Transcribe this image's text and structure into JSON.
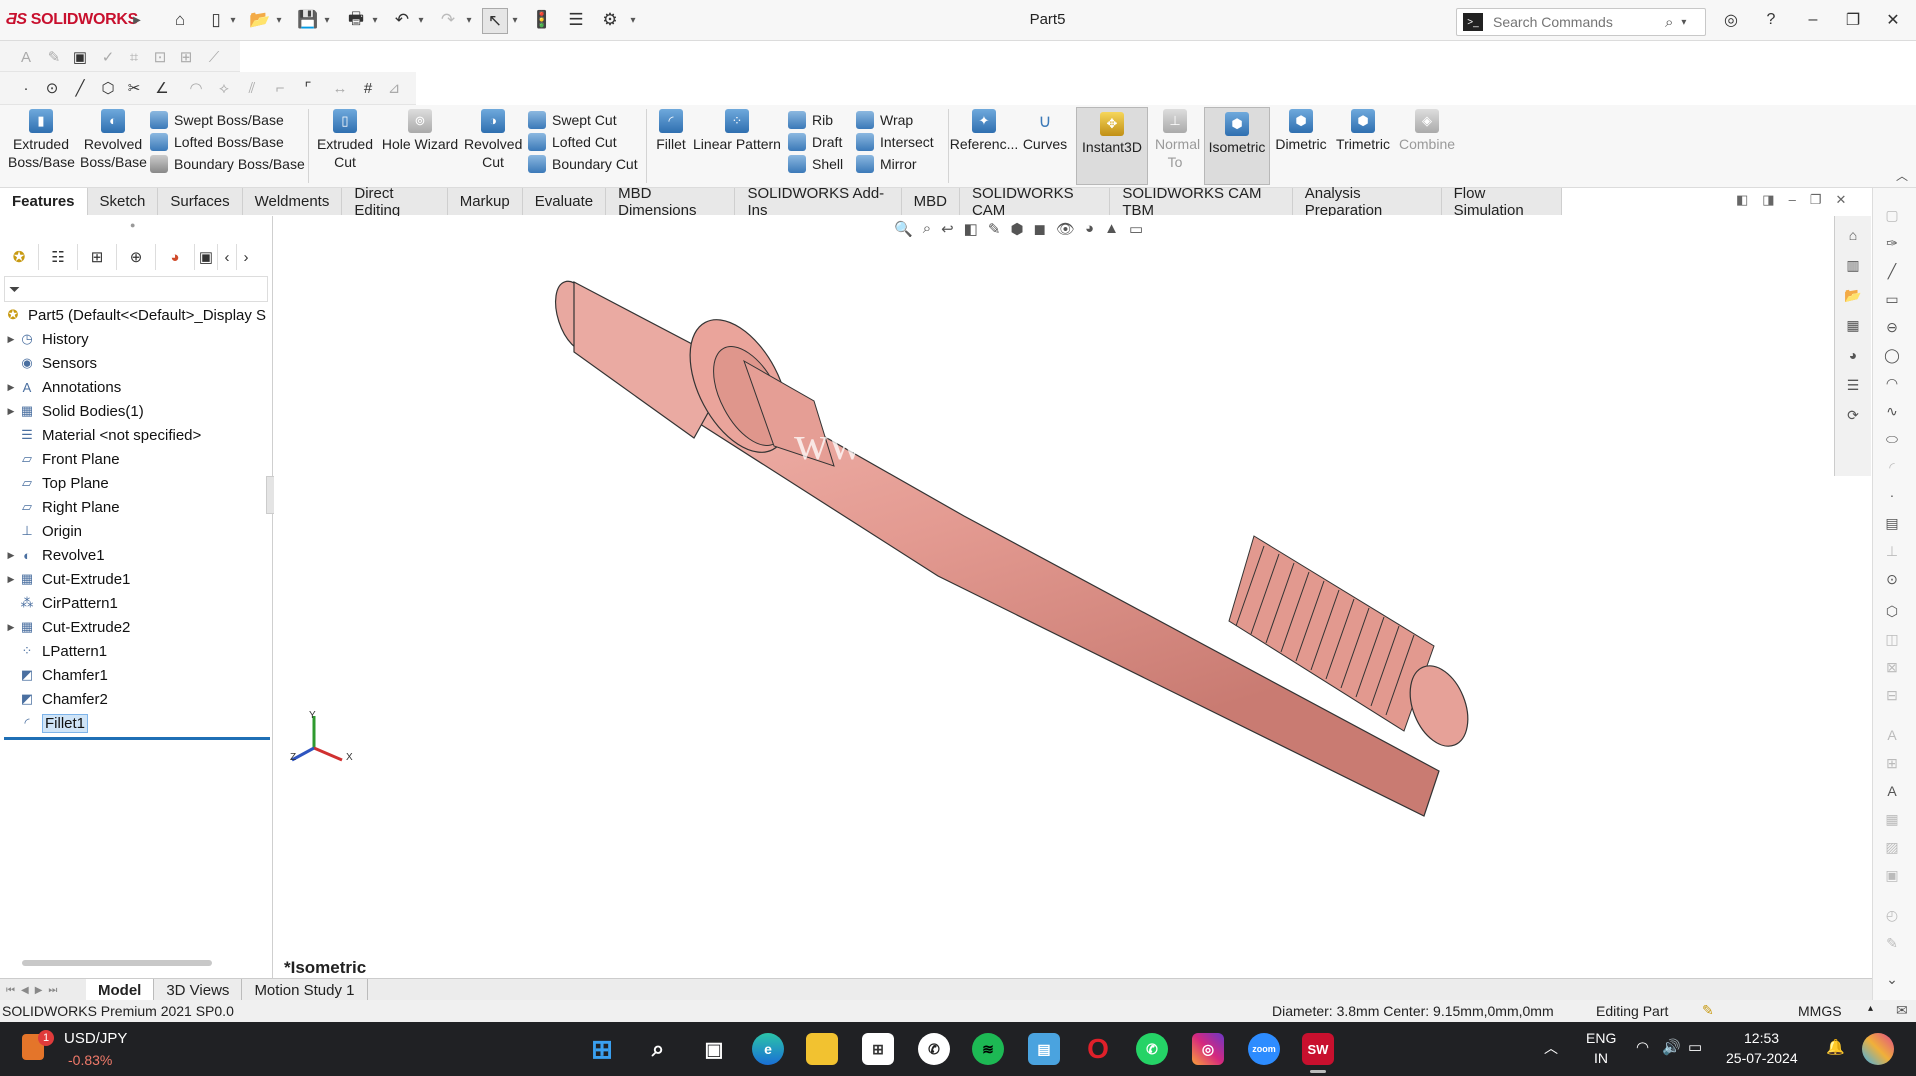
{
  "app": {
    "name": "SOLIDWORKS",
    "document_title": "Part5"
  },
  "search": {
    "placeholder": "Search Commands"
  },
  "commands": {
    "extruded_boss": "Extruded Boss/Base",
    "revolved_boss": "Revolved Boss/Base",
    "swept_boss": "Swept Boss/Base",
    "lofted_boss": "Lofted Boss/Base",
    "boundary_boss": "Boundary Boss/Base",
    "extruded_cut": "Extruded Cut",
    "hole_wizard": "Hole Wizard",
    "revolved_cut": "Revolved Cut",
    "swept_cut": "Swept Cut",
    "lofted_cut": "Lofted Cut",
    "boundary_cut": "Boundary Cut",
    "fillet": "Fillet",
    "linear_pattern": "Linear Pattern",
    "rib": "Rib",
    "draft": "Draft",
    "shell": "Shell",
    "wrap": "Wrap",
    "intersect": "Intersect",
    "mirror": "Mirror",
    "reference": "Referenc...",
    "curves": "Curves",
    "instant3d": "Instant3D",
    "normal_to": "Normal To",
    "isometric": "Isometric",
    "dimetric": "Dimetric",
    "trimetric": "Trimetric",
    "combine": "Combine"
  },
  "tabs": [
    "Features",
    "Sketch",
    "Surfaces",
    "Weldments",
    "Direct Editing",
    "Markup",
    "Evaluate",
    "MBD Dimensions",
    "SOLIDWORKS Add-Ins",
    "MBD",
    "SOLIDWORKS CAM",
    "SOLIDWORKS CAM TBM",
    "Analysis Preparation",
    "Flow Simulation"
  ],
  "tree": {
    "root": "Part5  (Default<<Default>_Display S",
    "items": [
      "History",
      "Sensors",
      "Annotations",
      "Solid Bodies(1)",
      "Material <not specified>",
      "Front Plane",
      "Top Plane",
      "Right Plane",
      "Origin",
      "Revolve1",
      "Cut-Extrude1",
      "CirPattern1",
      "Cut-Extrude2",
      "LPattern1",
      "Chamfer1",
      "Chamfer2",
      "Fillet1"
    ]
  },
  "viewport": {
    "view_label": "*Isometric",
    "watermark": "www. 3dmo",
    "triad": {
      "x": "X",
      "y": "Y",
      "z": "Z"
    }
  },
  "bottom_tabs": [
    "Model",
    "3D Views",
    "Motion Study 1"
  ],
  "status": {
    "version": "SOLIDWORKS Premium 2021 SP0.0",
    "measure": "Diameter: 3.8mm  Center: 9.15mm,0mm,0mm",
    "mode": "Editing Part",
    "units": "MMGS"
  },
  "taskbar": {
    "ticker": "USD/JPY",
    "ticker_change": "-0.83%",
    "badge": "1",
    "lang_line1": "ENG",
    "lang_line2": "IN",
    "time": "12:53",
    "date": "25-07-2024"
  },
  "colors": {
    "part": "#e7a39b",
    "accent": "#c8102e",
    "selection": "#cfe4f7"
  }
}
